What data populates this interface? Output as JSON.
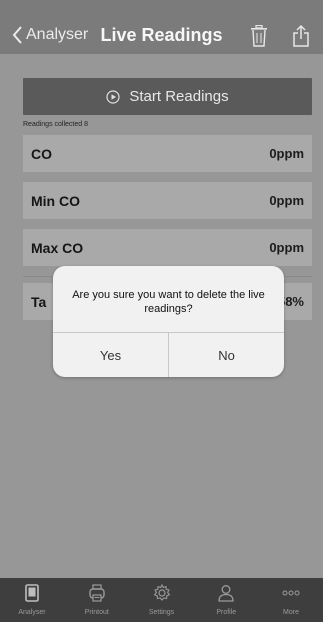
{
  "nav": {
    "back_label": "Analyser",
    "title": "Live Readings",
    "icons": [
      "trash-icon",
      "share-icon"
    ]
  },
  "start_button": {
    "label": "Start Readings",
    "icon": "play-circle-icon"
  },
  "collected_text": "Readings collected 8",
  "readings": [
    {
      "label": "CO",
      "value": "0ppm"
    },
    {
      "label": "Min CO",
      "value": "0ppm"
    },
    {
      "label": "Max CO",
      "value": "0ppm"
    },
    {
      "label": "Ta",
      "value": "58%"
    }
  ],
  "dialog": {
    "message": "Are you sure you want to delete the live readings?",
    "yes_label": "Yes",
    "no_label": "No"
  },
  "tabbar": {
    "items": [
      {
        "label": "Analyser",
        "icon": "device-icon"
      },
      {
        "label": "Printout",
        "icon": "printer-icon"
      },
      {
        "label": "Settings",
        "icon": "gear-icon"
      },
      {
        "label": "Profile",
        "icon": "person-icon"
      },
      {
        "label": "More",
        "icon": "more-dots-icon"
      }
    ]
  },
  "colors": {
    "overlay_background": "#979797",
    "nav_background": "#7b7b7b",
    "start_button": "#5a5a5a",
    "row_background": "#a9a9a9",
    "dialog_background": "#f1f1f1",
    "tabbar_background": "#3e3e3e"
  }
}
